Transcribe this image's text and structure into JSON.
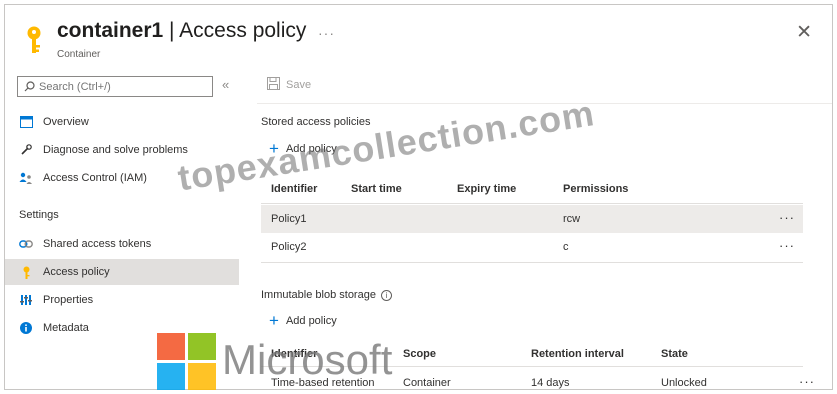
{
  "header": {
    "title_bold": "container1",
    "title_rest": " | Access policy",
    "subtitle": "Container",
    "more": "···",
    "close": "✕"
  },
  "sidebar": {
    "search_placeholder": "Search (Ctrl+/)",
    "collapse": "«",
    "items": [
      {
        "label": "Overview",
        "icon": "overview-icon"
      },
      {
        "label": "Diagnose and solve problems",
        "icon": "wrench-icon"
      },
      {
        "label": "Access Control (IAM)",
        "icon": "people-icon"
      }
    ],
    "settings_heading": "Settings",
    "settings_items": [
      {
        "label": "Shared access tokens",
        "icon": "link-icon"
      },
      {
        "label": "Access policy",
        "icon": "key-icon",
        "active": true
      },
      {
        "label": "Properties",
        "icon": "properties-icon"
      },
      {
        "label": "Metadata",
        "icon": "info-icon"
      }
    ]
  },
  "toolbar": {
    "save_label": "Save"
  },
  "stored": {
    "heading": "Stored access policies",
    "add_label": "Add policy",
    "columns": [
      "Identifier",
      "Start time",
      "Expiry time",
      "Permissions"
    ],
    "rows": [
      {
        "identifier": "Policy1",
        "start": "",
        "expiry": "",
        "permissions": "rcw",
        "more": "···"
      },
      {
        "identifier": "Policy2",
        "start": "",
        "expiry": "",
        "permissions": "c",
        "more": "···"
      }
    ]
  },
  "immutable": {
    "heading": "Immutable blob storage",
    "add_label": "Add policy",
    "columns": [
      "Identifier",
      "Scope",
      "Retention interval",
      "State"
    ],
    "rows": [
      {
        "identifier": "Time-based retention",
        "scope": "Container",
        "retention": "14 days",
        "state": "Unlocked",
        "more": "···"
      }
    ]
  },
  "watermarks": {
    "site": "topexamcollection.com",
    "brand": "Microsoft"
  },
  "colors": {
    "accent": "#0078d4",
    "key_yellow": "#ffb900",
    "ms_red": "#f25022",
    "ms_green": "#7fba00",
    "ms_blue": "#00a4ef",
    "ms_yellow": "#ffb900"
  }
}
